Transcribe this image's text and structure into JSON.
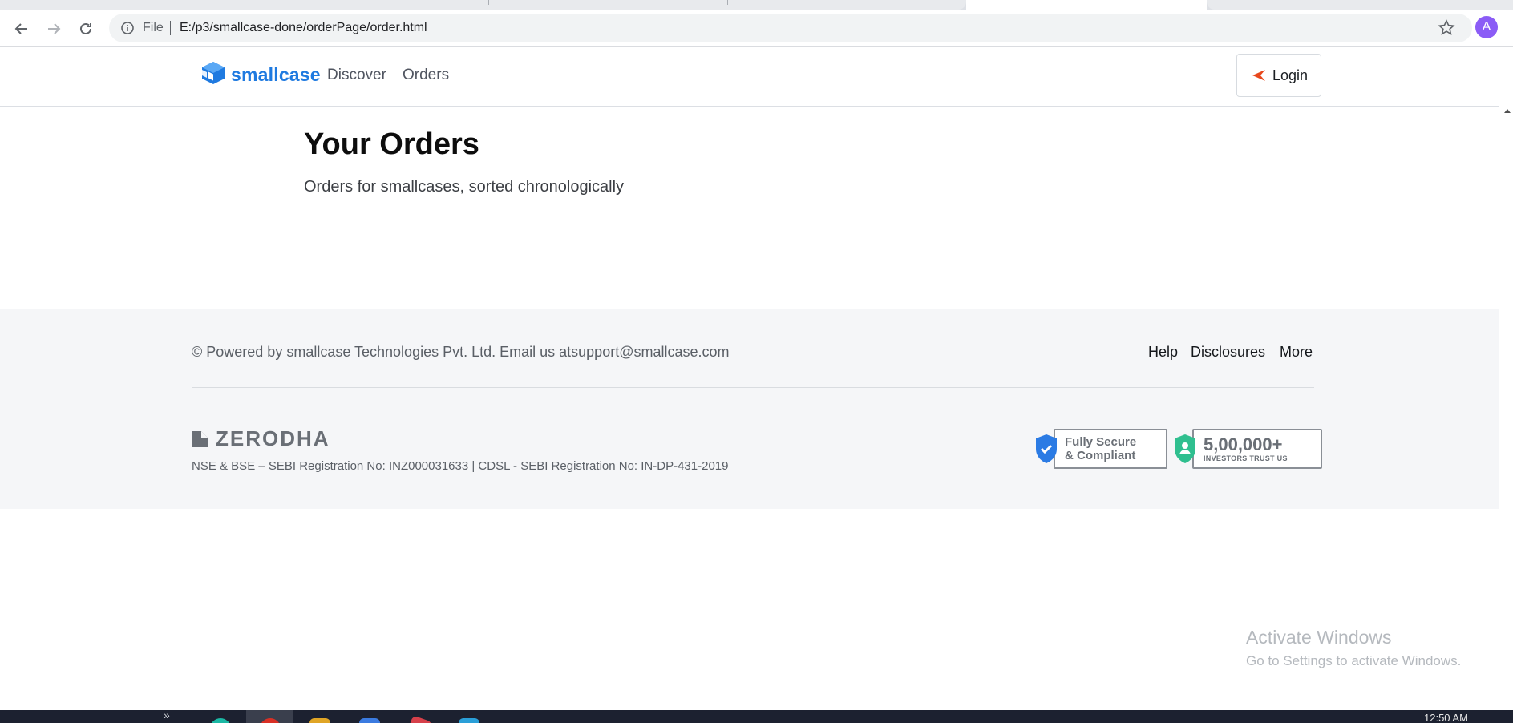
{
  "browser": {
    "scheme_label": "File",
    "url": "E:/p3/smallcase-done/orderPage/order.html",
    "profile_initial": "A"
  },
  "header": {
    "brand": "smallcase",
    "nav": {
      "discover": "Discover",
      "orders": "Orders"
    },
    "login_label": "Login",
    "brand_color": "#1f7ae0",
    "login_icon_color": "#e8471c"
  },
  "main": {
    "title": "Your Orders",
    "subtitle": "Orders for smallcases, sorted chronologically"
  },
  "footer": {
    "copyright": "© Powered by smallcase Technologies Pvt. Ltd. Email us atsupport@smallcase.com",
    "links": {
      "help": "Help",
      "disclosures": "Disclosures",
      "more": "More"
    },
    "partner_logo": "ZERODHA",
    "registration": "NSE & BSE – SEBI Registration No: INZ000031633 | CDSL - SEBI Registration No: IN-DP-431-2019",
    "badge_secure": {
      "line1": "Fully Secure",
      "line2": "& Compliant",
      "icon": "shield-check-icon",
      "color": "#2b7be4"
    },
    "badge_investors": {
      "count": "5,00,000+",
      "caption": "INVESTORS TRUST US",
      "icon": "shield-user-icon",
      "color": "#2fbf8f"
    }
  },
  "watermark": {
    "title": "Activate Windows",
    "subtitle": "Go to Settings to activate Windows."
  },
  "taskbar": {
    "clock": "12:50 AM"
  }
}
